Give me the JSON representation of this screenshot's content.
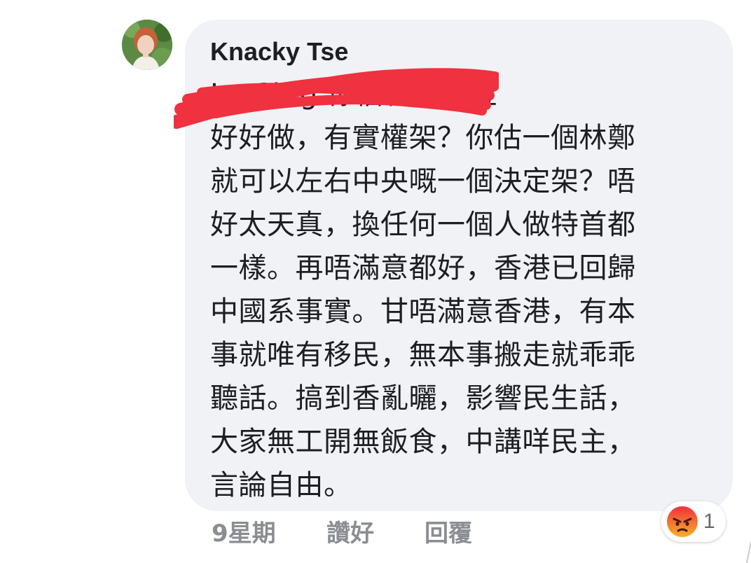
{
  "comment": {
    "author": "Knacky Tse",
    "lines": [
      "Le Ch   g 你估特首個位",
      "好好做，有實權架？你估一個林鄭",
      "就可以左右中央嘅一個決定架？唔",
      "好太天真，換任何一個人做特首都",
      "一樣。再唔滿意都好，香港已回歸",
      "中國系事實。甘唔滿意香港，有本",
      "事就唯有移民，無本事搬走就乖乖",
      "聽話。搞到香亂曬，影響民生話，",
      "大家無工開無飯食，中講咩民主，",
      "言論自由。"
    ]
  },
  "actions": {
    "time": "9星期",
    "like_label": "讚好",
    "reply_label": "回覆"
  },
  "reaction": {
    "icon": "angry-face-icon",
    "count": "1",
    "color": "#e9710f"
  },
  "colors": {
    "bubble": "#f0f2f5",
    "text": "#1c1e21",
    "meta": "#8a8d91",
    "redaction": "#f0313f"
  }
}
